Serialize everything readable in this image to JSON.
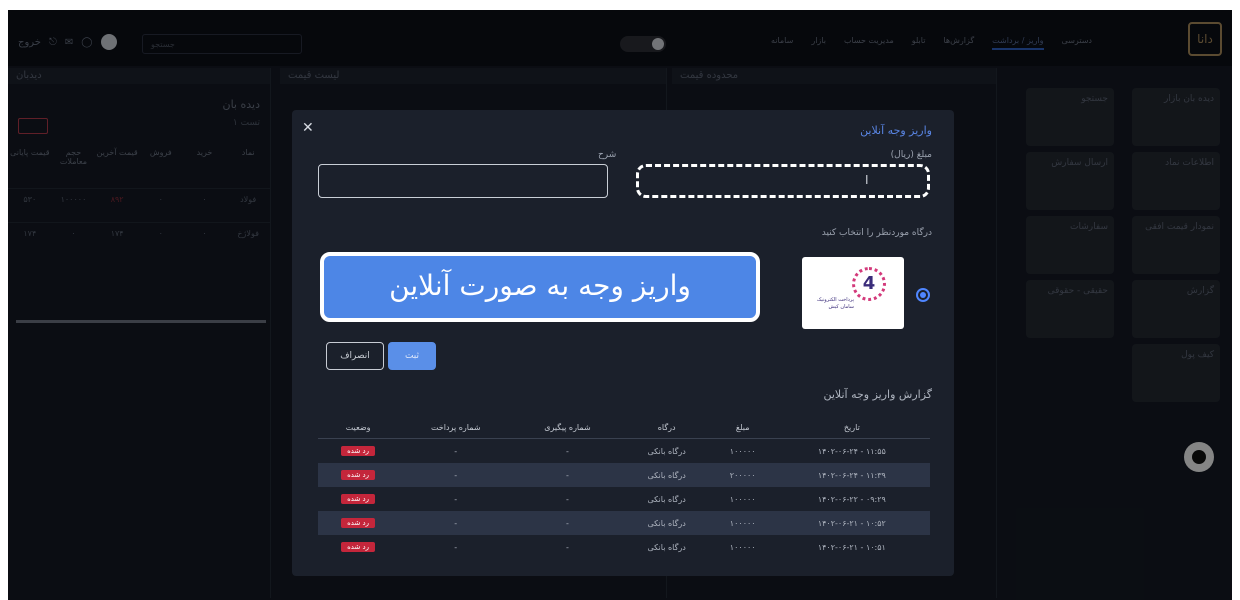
{
  "topbar": {
    "logo": "دانا",
    "menu": [
      "دسترسی",
      "واریز / برداشت",
      "گزارش‌ها",
      "تابلو",
      "مدیریت حساب",
      "بازار",
      "سامانه"
    ],
    "search_placeholder": "جستجو",
    "left_label": "خروج"
  },
  "panels": {
    "watch_title": "دیده بان",
    "watch_subtab": "تست ۱",
    "left_tab": "دیدبان",
    "mid1_tab": "لیست قیمت",
    "mid2_tab": "محدوده قیمت",
    "watch_headers": [
      "نماد",
      "خرید",
      "فروش",
      "قیمت آخرین",
      "حجم معاملات",
      "قیمت پایانی"
    ],
    "watch_rows": [
      [
        "فولاد",
        "۰",
        "۰",
        "۸۹۲",
        "۱۰۰۰۰۰",
        "۵۳۰"
      ],
      [
        "فولاژخ",
        "۰",
        "۰",
        "۱۷۴",
        "۰",
        "۱۷۴"
      ]
    ]
  },
  "tiles": [
    "دیده بان بازار",
    "جستجو",
    "اطلاعات نماد",
    "ارسال سفارش",
    "نمودار قیمت افقی",
    "سفارشات",
    "گزارش",
    "حقیقی - حقوقی",
    "کیف پول"
  ],
  "modal": {
    "title": "واریز وجه آنلاین",
    "amount_label": "مبلغ (ریال)",
    "desc_label": "شرح",
    "gateway_label": "درگاه موردنظر را انتخاب کنید",
    "gateway_logo_text": "پرداخت الکترونیک سامان کیش",
    "gateway_number": "4",
    "banner": "واریز وجه به صورت آنلاین",
    "submit": "ثبت",
    "cancel": "انصراف",
    "report_title": "گزارش واریز وجه آنلاین",
    "table_headers": [
      "تاریخ",
      "مبلغ",
      "درگاه",
      "شماره پیگیری",
      "شماره پرداخت",
      "وضعیت"
    ],
    "rows": [
      [
        "۱۴۰۲-۰۶-۲۴ - ۱۱:۵۵",
        "۱۰۰۰۰۰",
        "درگاه بانکی",
        "-",
        "-",
        "رد شده"
      ],
      [
        "۱۴۰۲-۰۶-۲۴ - ۱۱:۳۹",
        "۲۰۰۰۰۰",
        "درگاه بانکی",
        "-",
        "-",
        "رد شده"
      ],
      [
        "۱۴۰۲-۰۶-۲۲ - ۰۹:۲۹",
        "۱۰۰۰۰۰",
        "درگاه بانکی",
        "-",
        "-",
        "رد شده"
      ],
      [
        "۱۴۰۲-۰۶-۲۱ - ۱۰:۵۲",
        "۱۰۰۰۰۰",
        "درگاه بانکی",
        "-",
        "-",
        "رد شده"
      ],
      [
        "۱۴۰۲-۰۶-۲۱ - ۱۰:۵۱",
        "۱۰۰۰۰۰",
        "درگاه بانکی",
        "-",
        "-",
        "رد شده"
      ]
    ]
  }
}
